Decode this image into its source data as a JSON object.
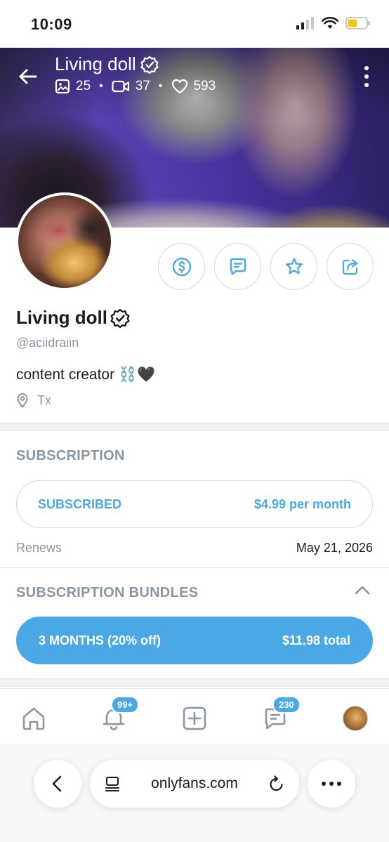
{
  "status_bar": {
    "time": "10:09"
  },
  "profile": {
    "name": "Living doll",
    "handle": "@aciidraiin",
    "bio": "content creator ⛓️🖤",
    "location": "Tx",
    "stats": {
      "photos": "25",
      "videos": "37",
      "likes": "593"
    }
  },
  "subscription": {
    "section_title": "SUBSCRIPTION",
    "status_label": "SUBSCRIBED",
    "price": "$4.99 per month",
    "renews_label": "Renews",
    "renews_date": "May 21, 2026"
  },
  "bundles": {
    "section_title": "SUBSCRIPTION BUNDLES",
    "items": [
      {
        "label": "3 MONTHS (20% off)",
        "price": "$11.98 total"
      }
    ]
  },
  "bottom_nav": {
    "notifications_badge": "99+",
    "messages_badge": "230"
  },
  "browser": {
    "url": "onlyfans.com"
  },
  "icons": {
    "back": "arrow-left-icon",
    "verified": "verified-badge-icon",
    "tip": "dollar-icon",
    "message": "message-icon",
    "favorite": "star-icon",
    "share": "share-icon",
    "location": "location-pin-icon"
  },
  "colors": {
    "accent": "#4aa8e4",
    "muted": "#8a96a3"
  }
}
